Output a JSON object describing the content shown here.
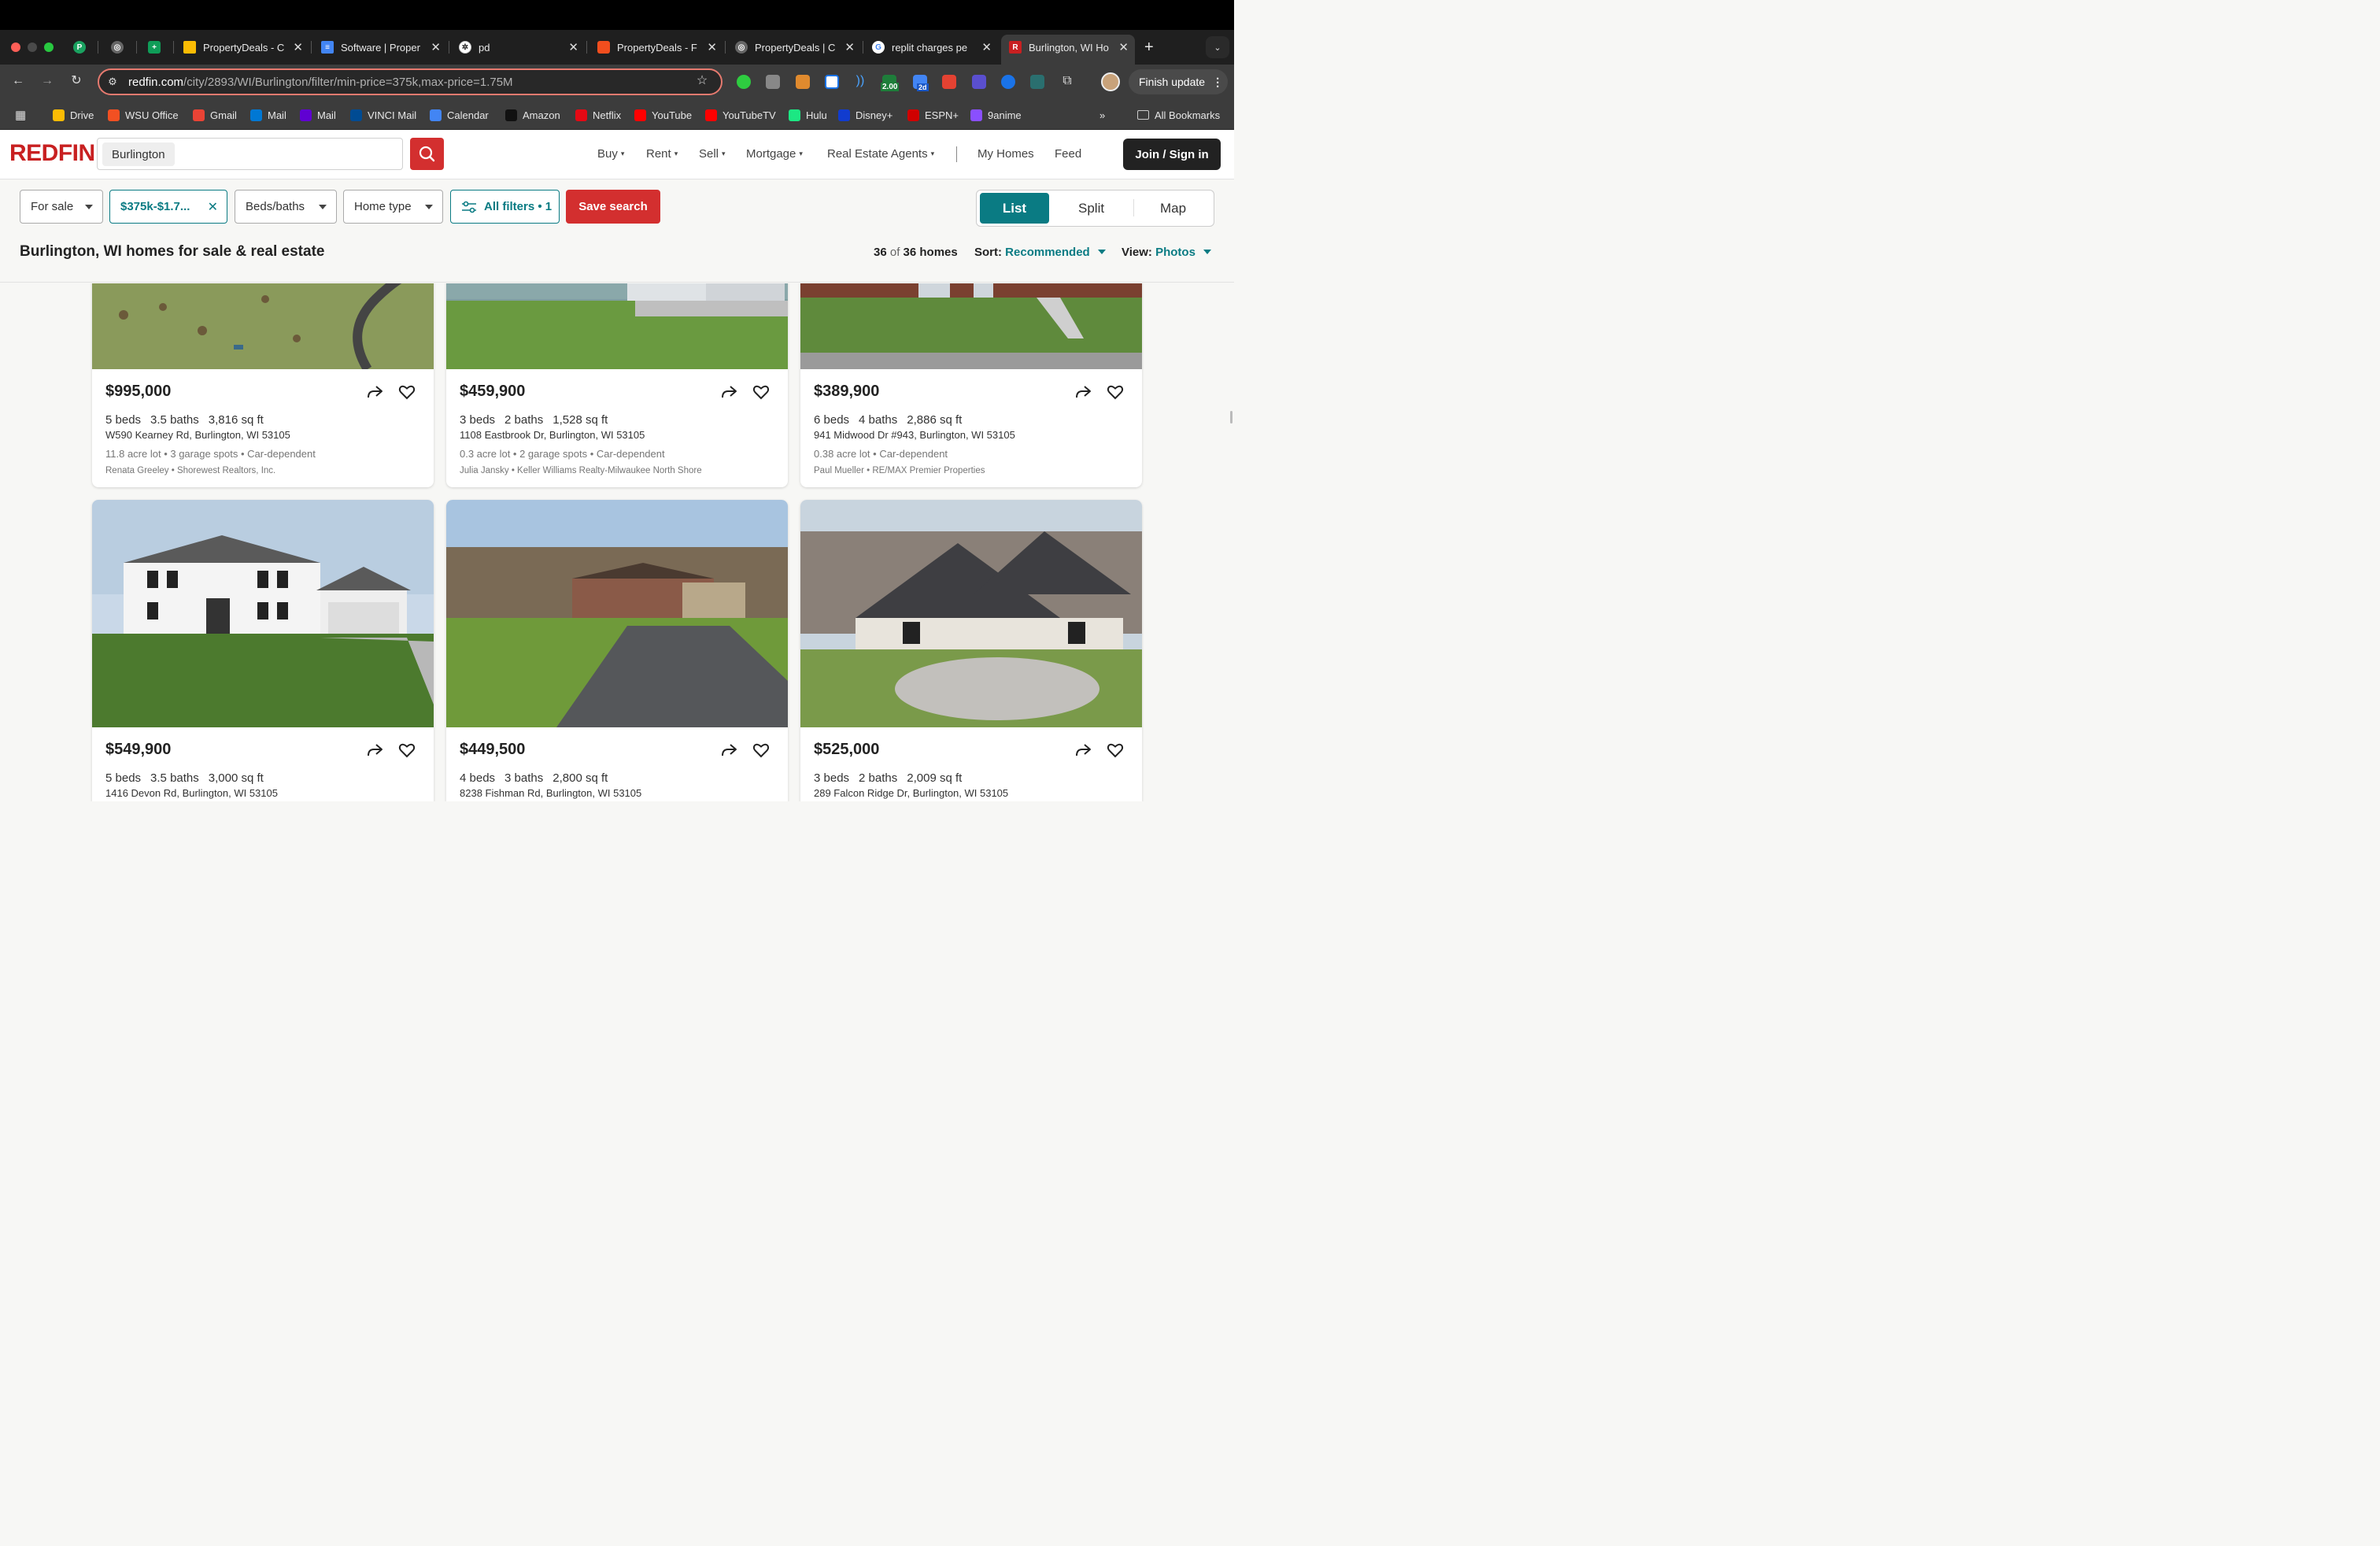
{
  "browser": {
    "tabs": [
      {
        "label": "",
        "icon": "pinned-p-icon",
        "color": "#1aa260"
      },
      {
        "label": "",
        "icon": "globe-icon",
        "color": "#888888"
      },
      {
        "label": "",
        "icon": "sheets-icon",
        "color": "#0f9d58"
      },
      {
        "label": "PropertyDeals - C",
        "icon": "drive-icon",
        "color": "#fbbc04"
      },
      {
        "label": "Software | Proper",
        "icon": "docs-icon",
        "color": "#4285f4"
      },
      {
        "label": "pd",
        "icon": "openai-icon",
        "color": "#444444"
      },
      {
        "label": "PropertyDeals - F",
        "icon": "figma-icon",
        "color": "#f24e1e"
      },
      {
        "label": "PropertyDeals | C",
        "icon": "globe-icon",
        "color": "#888888"
      },
      {
        "label": "replit charges pe",
        "icon": "google-icon",
        "color": "#4285f4"
      },
      {
        "label": "Burlington, WI Ho",
        "icon": "redfin-icon",
        "color": "#c82021"
      }
    ],
    "url_host": "redfin.com",
    "url_path": "/city/2893/WI/Burlington/filter/min-price=375k,max-price=1.75M",
    "finish_update": "Finish update",
    "ext_badge_1": "2.00",
    "ext_badge_2": "2d",
    "bookmarks": [
      {
        "label": "Drive",
        "color": "#fbbc04"
      },
      {
        "label": "WSU Office",
        "color": "#f25022"
      },
      {
        "label": "Gmail",
        "color": "#ea4335"
      },
      {
        "label": "Mail",
        "color": "#0078d4"
      },
      {
        "label": "Mail",
        "color": "#6001d2"
      },
      {
        "label": "VINCI Mail",
        "color": "#004b93"
      },
      {
        "label": "Calendar",
        "color": "#4285f4"
      },
      {
        "label": "Amazon",
        "color": "#111111"
      },
      {
        "label": "Netflix",
        "color": "#e50914"
      },
      {
        "label": "YouTube",
        "color": "#ff0000"
      },
      {
        "label": "YouTubeTV",
        "color": "#ff0000"
      },
      {
        "label": "Hulu",
        "color": "#1ce783"
      },
      {
        "label": "Disney+",
        "color": "#113ccf"
      },
      {
        "label": "ESPN+",
        "color": "#d00000"
      },
      {
        "label": "9anime",
        "color": "#8a4fff"
      }
    ],
    "all_bookmarks": "All Bookmarks",
    "overflow": "»"
  },
  "site": {
    "logo": "REDFIN",
    "search_value": "Burlington",
    "nav": [
      {
        "label": "Buy",
        "caret": true
      },
      {
        "label": "Rent",
        "caret": true
      },
      {
        "label": "Sell",
        "caret": true
      },
      {
        "label": "Mortgage",
        "caret": true
      },
      {
        "label": "Real Estate Agents",
        "caret": true
      },
      {
        "label": "My Homes",
        "caret": false
      },
      {
        "label": "Feed",
        "caret": false
      }
    ],
    "join_label": "Join / Sign in",
    "accent": "#0a7b83",
    "brand": "#d32f2f"
  },
  "filters": {
    "for_sale": "For sale",
    "price": "$375k-$1.7...",
    "beds_baths": "Beds/baths",
    "home_type": "Home type",
    "all_filters": "All filters • 1",
    "save_search": "Save search",
    "views": [
      "List",
      "Split",
      "Map"
    ],
    "selected_view": "List"
  },
  "results": {
    "title": "Burlington, WI homes for sale & real estate",
    "count_shown": "36",
    "count_of": "of",
    "count_total": "36 homes",
    "sort_label": "Sort:",
    "sort_value": "Recommended",
    "view_label": "View:",
    "view_value": "Photos"
  },
  "listings": [
    {
      "price": "$995,000",
      "beds": "5 beds",
      "baths": "3.5 baths",
      "sqft": "3,816 sq ft",
      "address": "W590 Kearney Rd, Burlington, WI 53105",
      "meta": "11.8 acre lot • 3 garage spots • Car-dependent",
      "agent": "Renata Greeley • Shorewest Realtors, Inc."
    },
    {
      "price": "$459,900",
      "beds": "3 beds",
      "baths": "2 baths",
      "sqft": "1,528 sq ft",
      "address": "1108 Eastbrook Dr, Burlington, WI 53105",
      "meta": "0.3 acre lot • 2 garage spots • Car-dependent",
      "agent": "Julia Jansky • Keller Williams Realty-Milwaukee North Shore"
    },
    {
      "price": "$389,900",
      "beds": "6 beds",
      "baths": "4 baths",
      "sqft": "2,886 sq ft",
      "address": "941 Midwood Dr #943, Burlington, WI 53105",
      "meta": "0.38 acre lot • Car-dependent",
      "agent": "Paul Mueller • RE/MAX Premier Properties"
    },
    {
      "price": "$549,900",
      "beds": "5 beds",
      "baths": "3.5 baths",
      "sqft": "3,000 sq ft",
      "address": "1416 Devon Rd, Burlington, WI 53105",
      "meta": "",
      "agent": ""
    },
    {
      "price": "$449,500",
      "beds": "4 beds",
      "baths": "3 baths",
      "sqft": "2,800 sq ft",
      "address": "8238 Fishman Rd, Burlington, WI 53105",
      "meta": "",
      "agent": ""
    },
    {
      "price": "$525,000",
      "beds": "3 beds",
      "baths": "2 baths",
      "sqft": "2,009 sq ft",
      "address": "289 Falcon Ridge Dr, Burlington, WI 53105",
      "meta": "",
      "agent": ""
    }
  ]
}
